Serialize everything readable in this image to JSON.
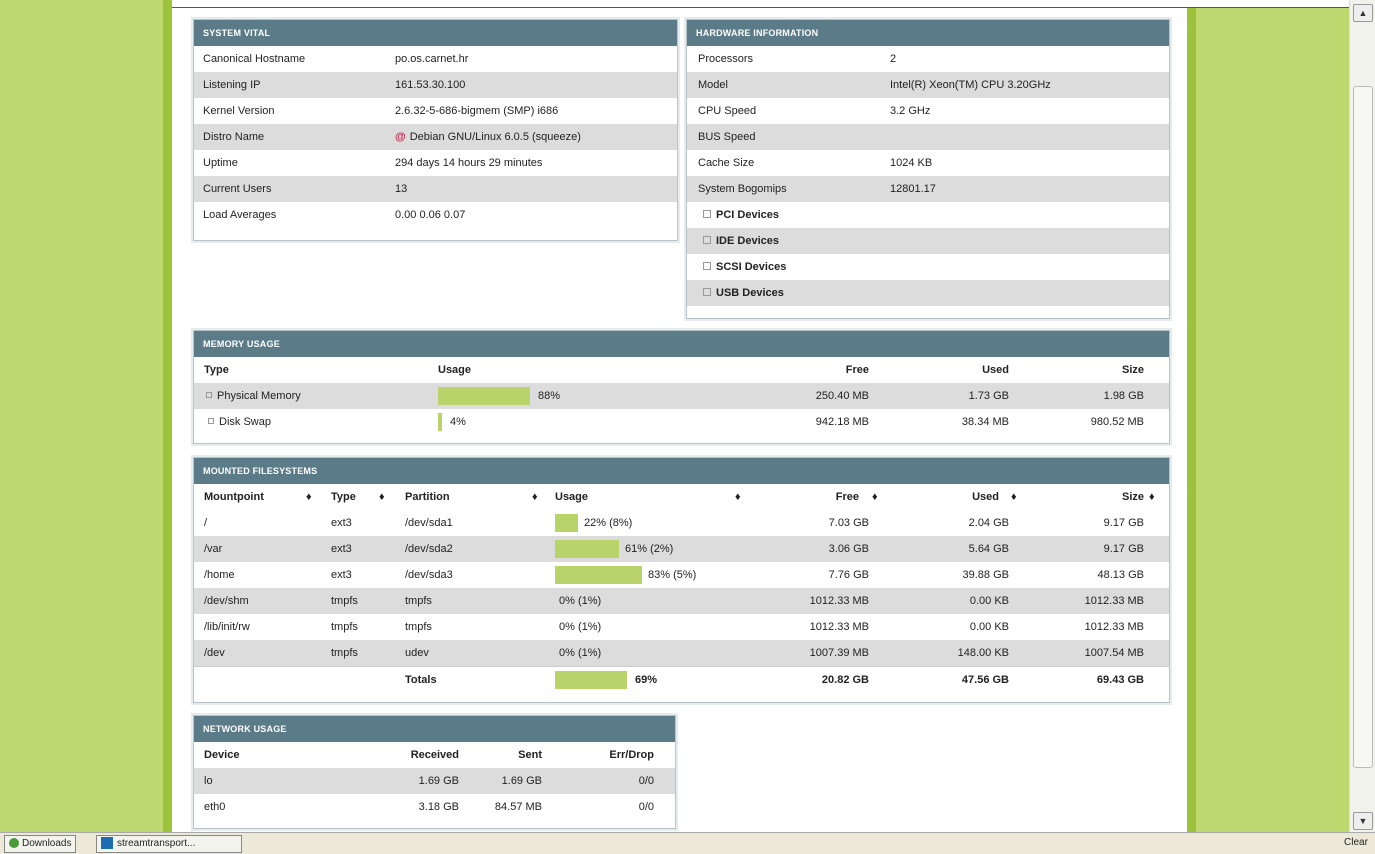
{
  "system_vital": {
    "title": "SYSTEM VITAL",
    "rows": [
      {
        "label": "Canonical Hostname",
        "value": "po.os.carnet.hr"
      },
      {
        "label": "Listening IP",
        "value": "161.53.30.100"
      },
      {
        "label": "Kernel Version",
        "value": "2.6.32-5-686-bigmem (SMP) i686"
      },
      {
        "label": "Distro Name",
        "value": "Debian GNU/Linux 6.0.5 (squeeze)"
      },
      {
        "label": "Uptime",
        "value": "294 days 14 hours 29 minutes"
      },
      {
        "label": "Current Users",
        "value": "13"
      },
      {
        "label": "Load Averages",
        "value": "0.00 0.06 0.07"
      }
    ]
  },
  "hardware": {
    "title": "HARDWARE INFORMATION",
    "rows": [
      {
        "label": "Processors",
        "value": "2"
      },
      {
        "label": "Model",
        "value": "Intel(R) Xeon(TM) CPU 3.20GHz"
      },
      {
        "label": "CPU Speed",
        "value": "3.2 GHz"
      },
      {
        "label": "BUS Speed",
        "value": ""
      },
      {
        "label": "Cache Size",
        "value": "1024 KB"
      },
      {
        "label": "System Bogomips",
        "value": "12801.17"
      }
    ],
    "devices": [
      "PCI Devices",
      "IDE Devices",
      "SCSI Devices",
      "USB Devices"
    ]
  },
  "memory": {
    "title": "MEMORY USAGE",
    "headers": {
      "type": "Type",
      "usage": "Usage",
      "free": "Free",
      "used": "Used",
      "size": "Size"
    },
    "rows": [
      {
        "type": "Physical Memory",
        "usage_pct": 88,
        "usage": "88%",
        "free": "250.40 MB",
        "used": "1.73 GB",
        "size": "1.98 GB"
      },
      {
        "type": "Disk Swap",
        "usage_pct": 4,
        "usage": "4%",
        "free": "942.18 MB",
        "used": "38.34 MB",
        "size": "980.52 MB"
      }
    ]
  },
  "filesystems": {
    "title": "MOUNTED FILESYSTEMS",
    "headers": {
      "mountpoint": "Mountpoint",
      "type": "Type",
      "partition": "Partition",
      "usage": "Usage",
      "free": "Free",
      "used": "Used",
      "size": "Size"
    },
    "rows": [
      {
        "mountpoint": "/",
        "type": "ext3",
        "partition": "/dev/sda1",
        "usage_pct": 22,
        "usage": "22% (8%)",
        "free": "7.03 GB",
        "used": "2.04 GB",
        "size": "9.17 GB"
      },
      {
        "mountpoint": "/var",
        "type": "ext3",
        "partition": "/dev/sda2",
        "usage_pct": 61,
        "usage": "61% (2%)",
        "free": "3.06 GB",
        "used": "5.64 GB",
        "size": "9.17 GB"
      },
      {
        "mountpoint": "/home",
        "type": "ext3",
        "partition": "/dev/sda3",
        "usage_pct": 83,
        "usage": "83% (5%)",
        "free": "7.76 GB",
        "used": "39.88 GB",
        "size": "48.13 GB"
      },
      {
        "mountpoint": "/dev/shm",
        "type": "tmpfs",
        "partition": "tmpfs",
        "usage_pct": 0,
        "usage": "0% (1%)",
        "free": "1012.33 MB",
        "used": "0.00 KB",
        "size": "1012.33 MB"
      },
      {
        "mountpoint": "/lib/init/rw",
        "type": "tmpfs",
        "partition": "tmpfs",
        "usage_pct": 0,
        "usage": "0% (1%)",
        "free": "1012.33 MB",
        "used": "0.00 KB",
        "size": "1012.33 MB"
      },
      {
        "mountpoint": "/dev",
        "type": "tmpfs",
        "partition": "udev",
        "usage_pct": 0,
        "usage": "0% (1%)",
        "free": "1007.39 MB",
        "used": "148.00 KB",
        "size": "1007.54 MB"
      }
    ],
    "totals": {
      "label": "Totals",
      "usage_pct": 69,
      "usage": "69%",
      "free": "20.82 GB",
      "used": "47.56 GB",
      "size": "69.43 GB"
    }
  },
  "network": {
    "title": "NETWORK USAGE",
    "headers": {
      "device": "Device",
      "received": "Received",
      "sent": "Sent",
      "errdrop": "Err/Drop"
    },
    "rows": [
      {
        "device": "lo",
        "received": "1.69 GB",
        "sent": "1.69 GB",
        "errdrop": "0/0"
      },
      {
        "device": "eth0",
        "received": "3.18 GB",
        "sent": "84.57 MB",
        "errdrop": "0/0"
      }
    ]
  },
  "taskbar": {
    "downloads": "Downloads",
    "app": "streamtransport...",
    "clear": "Clear"
  },
  "colors": {
    "accent": "#5a7b87",
    "bar": "#b8d36a",
    "page_bg": "#bcd86e"
  }
}
